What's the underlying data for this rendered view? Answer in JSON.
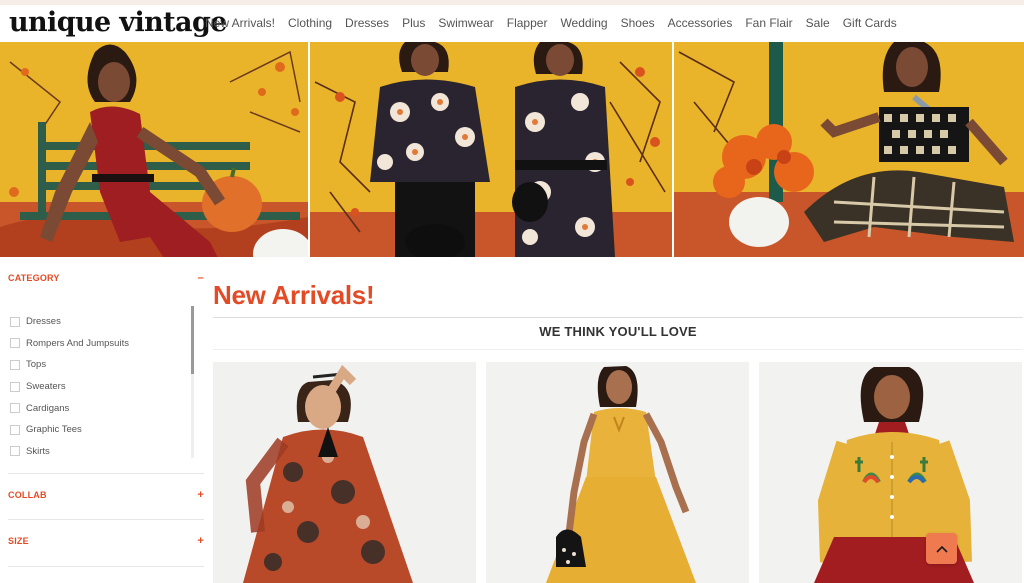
{
  "brand": {
    "logo_text": "unique vintage"
  },
  "nav": {
    "items": [
      "New Arrivals!",
      "Clothing",
      "Dresses",
      "Plus",
      "Swimwear",
      "Flapper",
      "Wedding",
      "Shoes",
      "Accessories",
      "Fan Flair",
      "Sale",
      "Gift Cards"
    ]
  },
  "filters": {
    "category": {
      "label": "CATEGORY",
      "toggle": "–",
      "items": [
        "Dresses",
        "Rompers And Jumpsuits",
        "Tops",
        "Sweaters",
        "Cardigans",
        "Graphic Tees",
        "Skirts"
      ]
    },
    "collab": {
      "label": "COLLAB",
      "toggle": "+"
    },
    "size": {
      "label": "SIZE",
      "toggle": "+"
    }
  },
  "main": {
    "title": "New Arrivals!",
    "section_heading": "WE THINK YOU'LL LOVE"
  },
  "colors": {
    "accent": "#e34b26",
    "hero_bg": "#eab42a",
    "back_to_top": "#ef7a4f"
  },
  "icons": {
    "back_to_top": "chevron-up-icon"
  }
}
